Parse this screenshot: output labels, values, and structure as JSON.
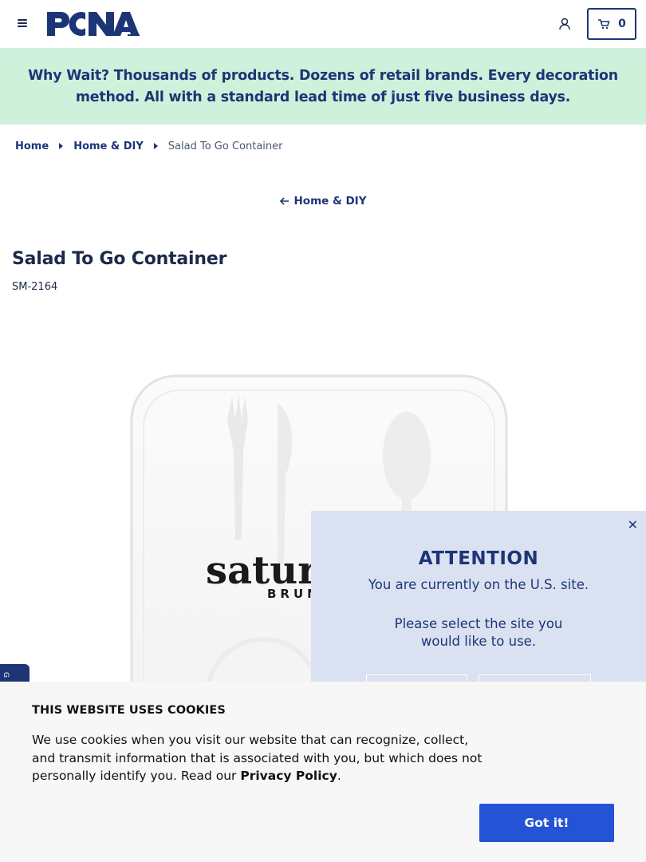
{
  "header": {
    "logo_text": "PCNA",
    "cart_count": "0",
    "icons": [
      "menu-icon",
      "account-icon",
      "cart-icon"
    ]
  },
  "promo": {
    "lead": "Why Wait?",
    "text": " Thousands of products. Dozens of retail brands. Every decoration method. All with a standard lead time of just five business days."
  },
  "breadcrumb": {
    "items": [
      "Home",
      "Home & DIY"
    ],
    "current": "Salad To Go Container"
  },
  "back_link": "Home & DIY",
  "product": {
    "title": "Salad To Go Container",
    "sku": "SM-2164",
    "image_brand_text": "BRUN"
  },
  "attention": {
    "title": "ATTENTION",
    "line1": "You are currently on the U.S. site.",
    "line2": "Please select the site you would like to use."
  },
  "cookie": {
    "title": "THIS WEBSITE USES COOKIES",
    "text": "We use cookies when you visit our website that can recognize, collect, and transmit information that is associated with you, but which does not personally identify you. Read our ",
    "link": "Privacy Policy",
    "after": ".",
    "button": "Got it!"
  },
  "colors": {
    "brand_navy": "#1d3576",
    "promo_bg": "#cdf1db",
    "attention_bg": "#dae2f1",
    "cookie_button": "#2453d6"
  }
}
